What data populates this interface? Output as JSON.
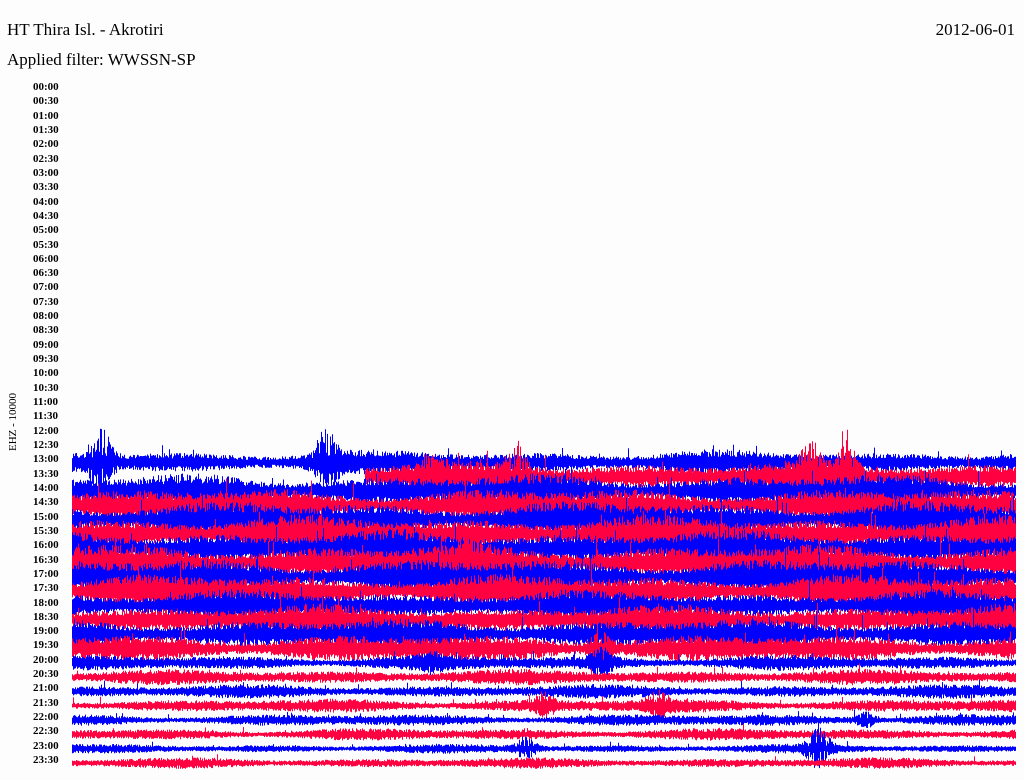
{
  "header": {
    "title": "HT Thira Isl. - Akrotiri",
    "date": "2012-06-01",
    "filter": "Applied filter: WWSSN-SP"
  },
  "chart_data": {
    "type": "line",
    "title": "HT Thira Isl. - Akrotiri",
    "ylabel": "EHZ - 10000",
    "row_minutes": 30,
    "colors": {
      "even": "#0000ff",
      "odd": "#ff0040"
    },
    "tick_labels": [
      "00:00",
      "00:30",
      "01:00",
      "01:30",
      "02:00",
      "02:30",
      "03:00",
      "03:30",
      "04:00",
      "04:30",
      "05:00",
      "05:30",
      "06:00",
      "06:30",
      "07:00",
      "07:30",
      "08:00",
      "08:30",
      "09:00",
      "09:30",
      "10:00",
      "10:30",
      "11:00",
      "11:30",
      "12:00",
      "12:30",
      "13:00",
      "13:30",
      "14:00",
      "14:30",
      "15:00",
      "15:30",
      "16:00",
      "16:30",
      "17:00",
      "17:30",
      "18:00",
      "18:30",
      "19:00",
      "19:30",
      "20:00",
      "20:30",
      "21:00",
      "21:30",
      "22:00",
      "22:30",
      "23:00",
      "23:30"
    ],
    "data_start": "13:00",
    "row_amplitude": {
      "13:00": 8,
      "13:30": 10,
      "14:00": 11,
      "14:30": 11,
      "15:00": 12,
      "15:30": 12,
      "16:00": 12,
      "16:30": 12,
      "17:00": 12,
      "17:30": 11,
      "18:00": 10,
      "18:30": 10,
      "19:00": 10,
      "19:30": 9,
      "20:00": 5,
      "20:30": 5,
      "21:00": 4.5,
      "21:30": 4.5,
      "22:00": 4,
      "22:30": 4,
      "23:00": 3,
      "23:30": 3.5
    },
    "events": [
      {
        "row": "13:00",
        "pos": 0.03,
        "amp": 35
      },
      {
        "row": "13:00",
        "pos": 0.27,
        "amp": 30
      },
      {
        "row": "13:30",
        "pos": 0.38,
        "amp": 18
      },
      {
        "row": "13:30",
        "pos": 0.47,
        "amp": 30
      },
      {
        "row": "13:30",
        "pos": 0.78,
        "amp": 28
      },
      {
        "row": "13:30",
        "pos": 0.82,
        "amp": 40
      },
      {
        "row": "16:30",
        "pos": 0.42,
        "amp": 25
      },
      {
        "row": "19:30",
        "pos": 0.56,
        "amp": 15
      },
      {
        "row": "20:00",
        "pos": 0.56,
        "amp": 14
      },
      {
        "row": "20:00",
        "pos": 0.38,
        "amp": 8
      },
      {
        "row": "21:30",
        "pos": 0.5,
        "amp": 10
      },
      {
        "row": "21:30",
        "pos": 0.62,
        "amp": 12
      },
      {
        "row": "22:00",
        "pos": 0.84,
        "amp": 8
      },
      {
        "row": "23:00",
        "pos": 0.48,
        "amp": 12
      },
      {
        "row": "23:00",
        "pos": 0.79,
        "amp": 22
      }
    ]
  }
}
